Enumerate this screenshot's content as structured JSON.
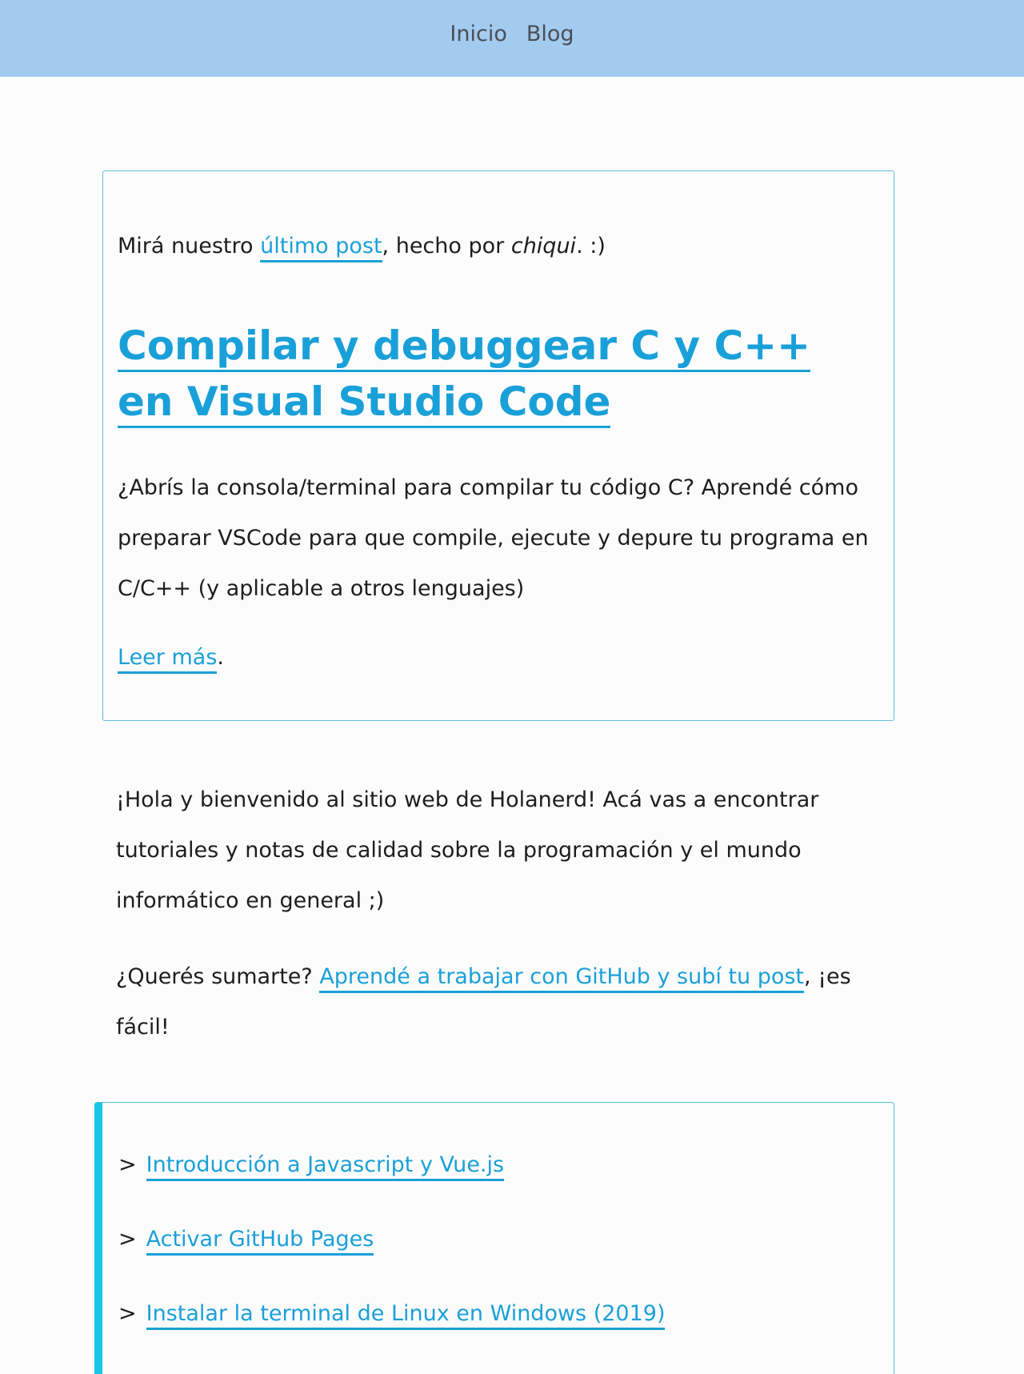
{
  "nav": {
    "items": [
      "Inicio",
      "Blog"
    ]
  },
  "featured": {
    "intro_prefix": "Mirá nuestro ",
    "intro_link": "último post",
    "intro_middle": ", hecho por ",
    "intro_author": "chiqui",
    "intro_suffix": ". :)",
    "title": "Compilar y debuggear C y C++ en Visual Studio Code",
    "description": "¿Abrís la consola/terminal para compilar tu código C? Aprendé cómo preparar VSCode para que compile, ejecute y depure tu programa en C/C++ (y aplicable a otros lenguajes)",
    "read_more": "Leer más",
    "read_more_suffix": "."
  },
  "welcome": {
    "text": "¡Hola y bienvenido al sitio web de Holanerd! Acá vas a encontrar tutoriales y notas de calidad sobre la programación y el mundo informático en general ;)"
  },
  "join": {
    "prefix": "¿Querés sumarte? ",
    "link": "Aprendé a trabajar con GitHub y subí tu post",
    "suffix": ", ¡es fácil!"
  },
  "posts": {
    "arrow": ">",
    "items": [
      "Introducción a Javascript y Vue.js",
      "Activar GitHub Pages",
      "Instalar la terminal de Linux en Windows (2019)"
    ]
  },
  "colors": {
    "nav_bg": "#a3cbf0",
    "link": "#1aa0d8",
    "card_border": "#5cc0d6",
    "accent_bar": "#17c6e3"
  }
}
